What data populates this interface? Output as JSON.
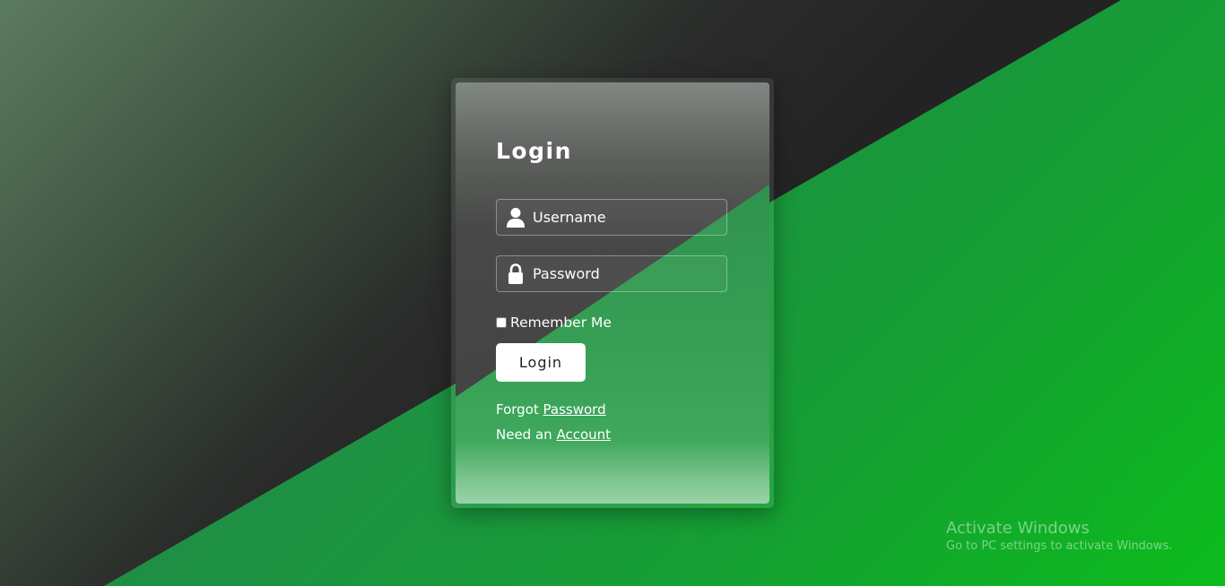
{
  "login": {
    "title": "Login",
    "username_placeholder": "Username",
    "password_placeholder": "Password",
    "remember_label": "Remember Me",
    "button_label": "Login",
    "forgot_prefix": "Forgot",
    "forgot_link": "Password",
    "need_prefix": "Need an",
    "need_link": "Account"
  },
  "watermark": {
    "title": "Activate Windows",
    "subtitle": "Go to PC settings to activate Windows."
  },
  "icons": {
    "username": "user-icon",
    "password": "lock-icon"
  },
  "colors": {
    "accent_green": "#159e33",
    "dark_background": "#222222",
    "button_background": "#ffffff"
  }
}
